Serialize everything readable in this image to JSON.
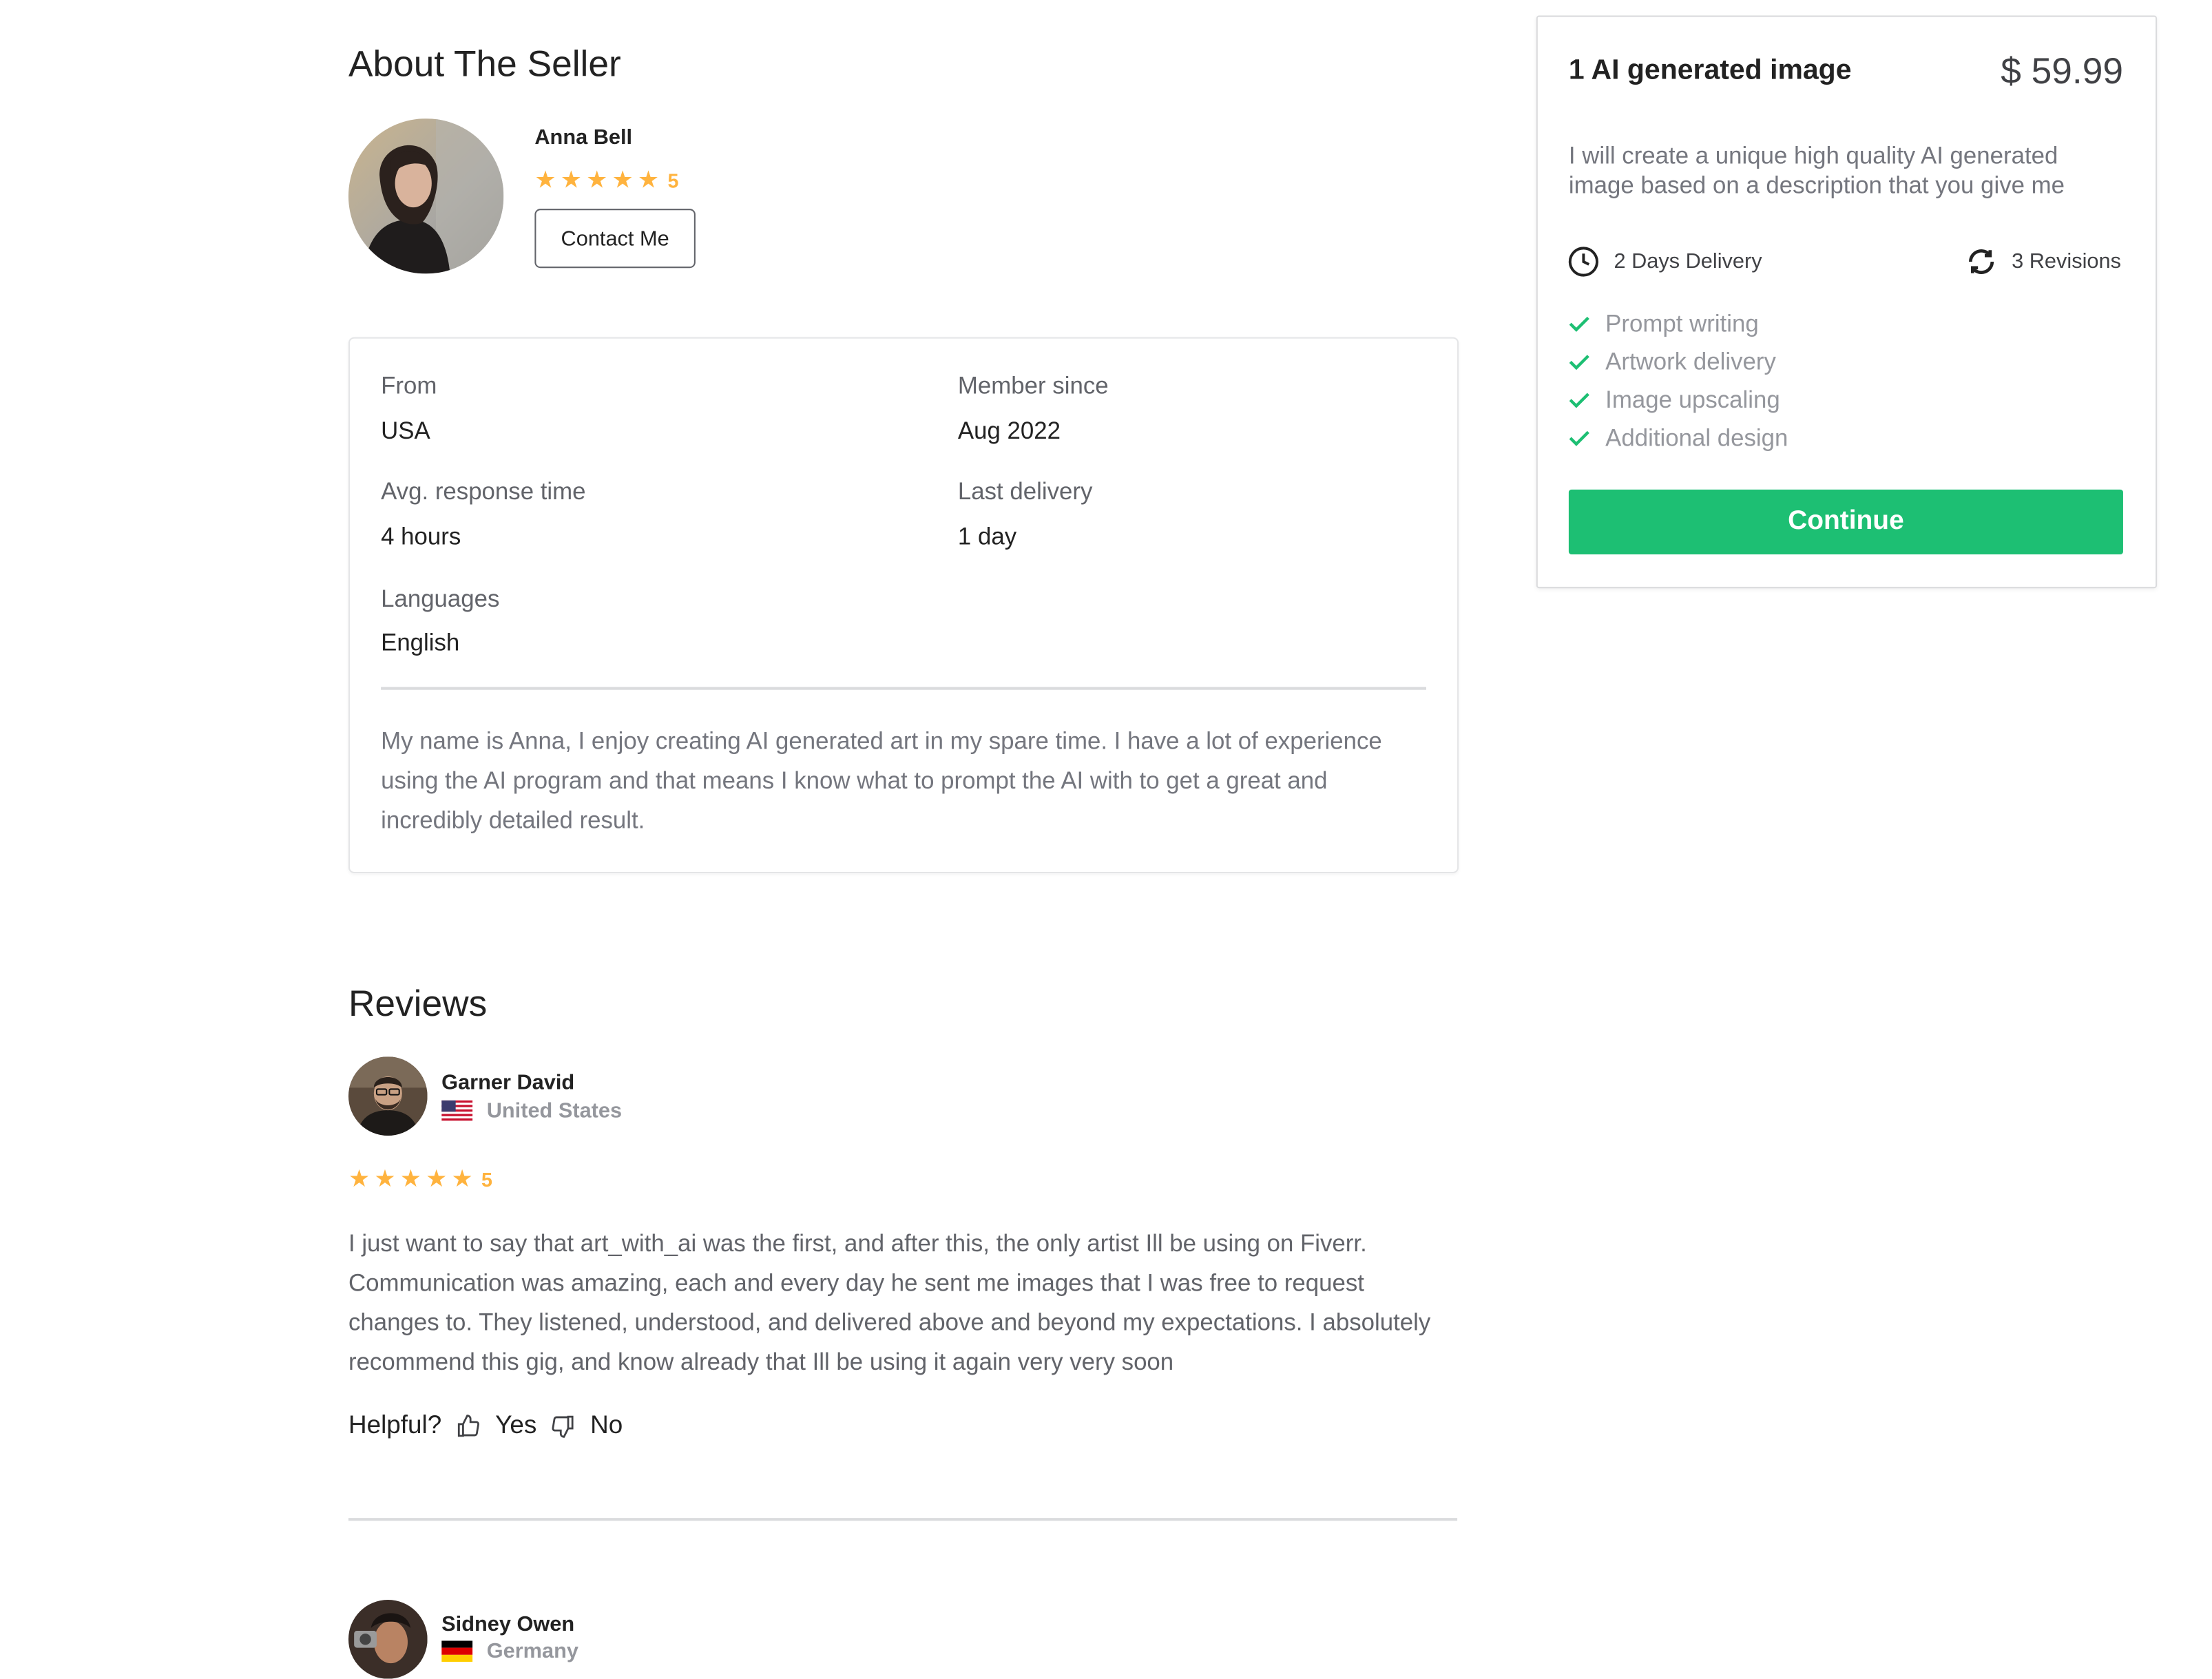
{
  "about": {
    "title": "About The Seller",
    "seller": {
      "name": "Anna Bell",
      "rating": "5",
      "contact_label": "Contact Me"
    },
    "info": {
      "from_label": "From",
      "from_value": "USA",
      "member_label": "Member since",
      "member_value": "Aug 2022",
      "response_label": "Avg. response time",
      "response_value": "4 hours",
      "last_delivery_label": "Last delivery",
      "last_delivery_value": "1 day",
      "languages_label": "Languages",
      "languages_value": "English"
    },
    "description": "My name is Anna, I enjoy creating AI generated art in my spare time. I have a lot of experience using the AI program and that means I know what to prompt the AI with to get a great and incredibly detailed result."
  },
  "reviews": {
    "title": "Reviews",
    "items": [
      {
        "name": "Garner David",
        "country": "United States",
        "rating": "5",
        "text": "I just want to say that art_with_ai was the first, and after this, the only artist Ill be using on Fiverr. Communication was amazing, each and every day he sent me images that I was free to request changes to. They listened, understood, and delivered above and beyond my expectations. I absolutely recommend this gig, and know already that Ill be using it again very very soon",
        "helpful_label": "Helpful?",
        "yes_label": "Yes",
        "no_label": "No"
      },
      {
        "name": "Sidney Owen",
        "country": "Germany"
      }
    ]
  },
  "package": {
    "title": "1 AI generated image",
    "price": "$ 59.99",
    "description": "I will create a unique high quality AI generated image based on a description that you give me",
    "delivery": "2 Days Delivery",
    "revisions": "3 Revisions",
    "features": [
      "Prompt writing",
      "Artwork delivery",
      "Image upscaling",
      "Additional design"
    ],
    "continue_label": "Continue"
  },
  "colors": {
    "accent": "#1dbf73",
    "star": "#ffb33e"
  }
}
